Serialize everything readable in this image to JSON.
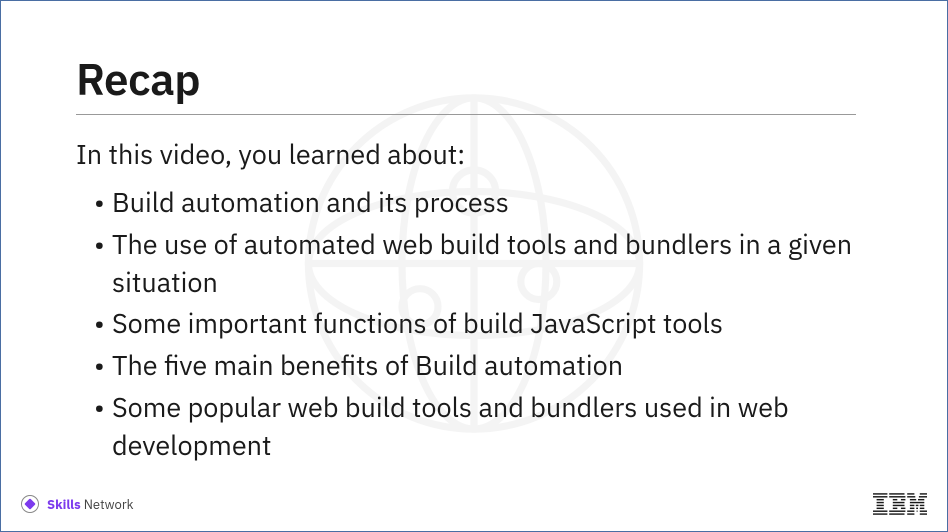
{
  "slide": {
    "title": "Recap",
    "intro": "In this video, you learned about:",
    "bullets": [
      "Build automation and its process",
      "The use of automated web build tools and bundlers in a given situation",
      "Some important functions of build JavaScript tools",
      "The five main benefits of Build automation",
      "Some popular web build tools and bundlers used in web development"
    ]
  },
  "footer": {
    "skills_bold": "Skills",
    "skills_rest": " Network",
    "ibm_label": "IBM"
  }
}
